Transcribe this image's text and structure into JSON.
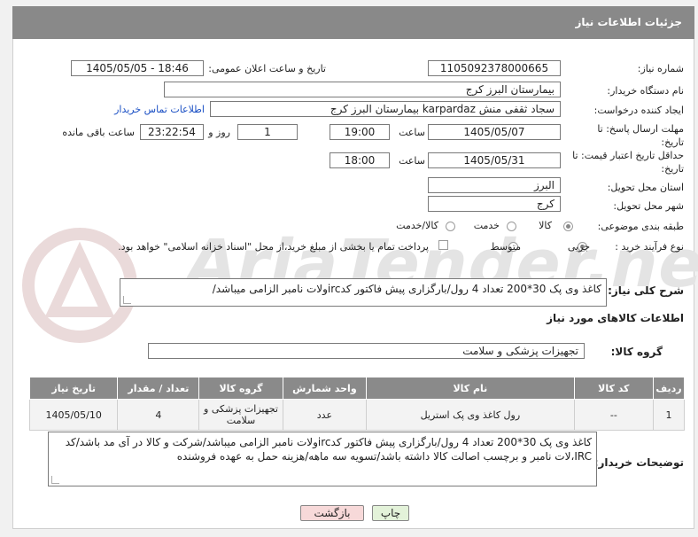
{
  "header": {
    "title": "جزئیات اطلاعات نیاز"
  },
  "watermark": {
    "text": "AriaTender.neT"
  },
  "fields": {
    "need_number_label": "شماره نیاز:",
    "need_number": "1105092378000665",
    "announce_label": "تاریخ و ساعت اعلان عمومی:",
    "announce_value": "1405/05/05 - 18:46",
    "buyer_org_label": "نام دستگاه خریدار:",
    "buyer_org": "بیمارستان البرز کرج",
    "creator_label": "ایجاد کننده درخواست:",
    "creator": "سجاد ثقفی منش karpardaz بیمارستان البرز کرج",
    "contact_link": "اطلاعات تماس خریدار",
    "deadline_label": "مهلت ارسال پاسخ: تا تاریخ:",
    "deadline_date": "1405/05/07",
    "time_label": "ساعت",
    "deadline_time": "19:00",
    "days_value": "1",
    "days_label": "روز و",
    "remaining_value": "23:22:54",
    "remaining_label": "ساعت باقی مانده",
    "validity_label": "حداقل تاریخ اعتبار قیمت: تا تاریخ:",
    "validity_date": "1405/05/31",
    "validity_time_label": "ساعت",
    "validity_time": "18:00",
    "province_label": "استان محل تحویل:",
    "province": "البرز",
    "city_label": "شهر محل تحویل:",
    "city": "کرج",
    "category_label": "طبقه بندی موضوعی:",
    "category_options": [
      "کالا",
      "خدمت",
      "کالا/خدمت"
    ],
    "process_label": "نوع فرآیند خرید :",
    "process_options": [
      "جزیی",
      "متوسط"
    ],
    "payment_note": "پرداخت تمام یا بخشی از مبلغ خرید،از محل \"اسناد خزانه اسلامی\" خواهد بود."
  },
  "description": {
    "label": "شرح کلی نیاز:",
    "text": "کاغذ وی پک 30*200 تعداد 4 رول/بارگزاری پیش فاکتور کدircولات نامبر الزامی میباشد/"
  },
  "goods_section": {
    "title": "اطلاعات کالاهای مورد نیاز",
    "group_label": "گروه کالا:",
    "group_value": "تجهیزات پزشکی و سلامت"
  },
  "table": {
    "headers": [
      "ردیف",
      "کد کالا",
      "نام کالا",
      "واحد شمارش",
      "گروه کالا",
      "تعداد / مقدار",
      "تاریخ نیاز"
    ],
    "rows": [
      [
        "1",
        "--",
        "رول کاغذ وی پک استریل",
        "عدد",
        "تجهیزات پزشکی و سلامت",
        "4",
        "1405/05/10"
      ]
    ]
  },
  "buyer_notes": {
    "label": "توضیحات خریدار:",
    "text": "کاغذ وی پک 30*200 تعداد 4 رول/بارگزاری پیش فاکتور کدircولات نامبر الزامی میباشد/شرکت و کالا در آی مد باشد/کد IRC،لات نامبر و برچسب اصالت کالا داشته باشد/تسویه سه ماهه/هزینه حمل به عهده فروشنده"
  },
  "buttons": {
    "print": "چاپ",
    "back": "بازگشت"
  },
  "colors": {
    "header": "#898989",
    "link": "#1a4fc4",
    "back_button": "#f7d9d9",
    "print_button": "#e3f2d9"
  }
}
